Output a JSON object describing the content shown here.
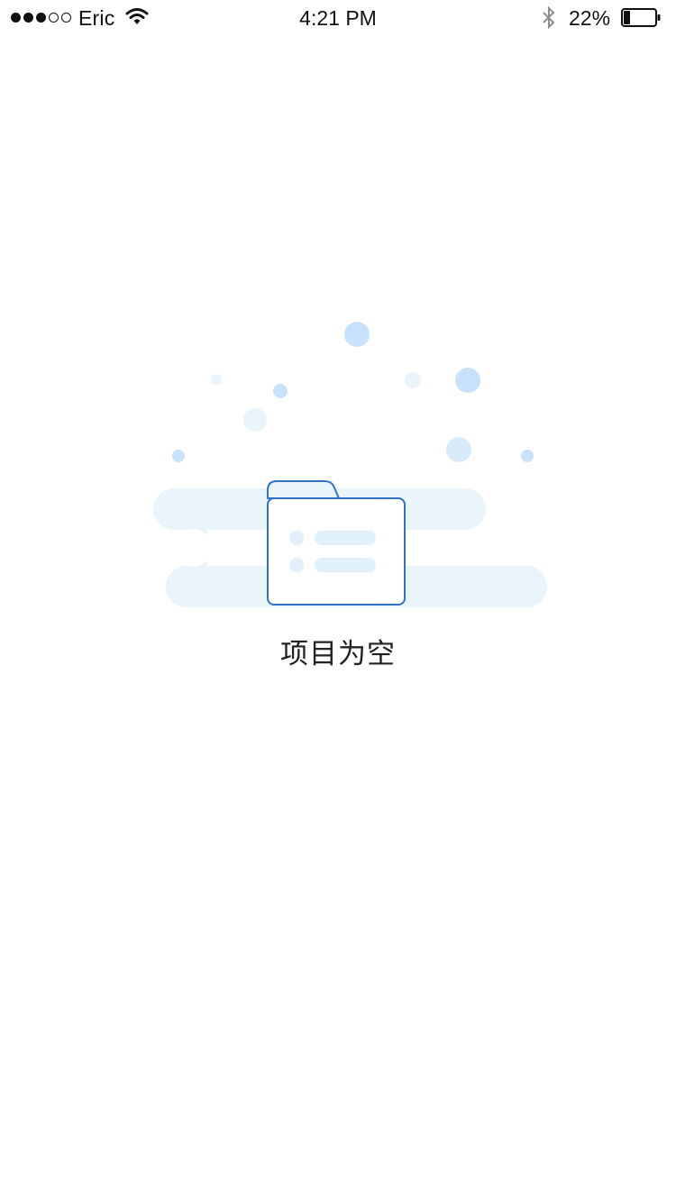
{
  "status_bar": {
    "carrier": "Eric",
    "time": "4:21 PM",
    "battery_percent": "22%",
    "battery_level": 0.22,
    "signal_strength": 3,
    "signal_max": 5,
    "icons": [
      "signal-dots-icon",
      "wifi-icon",
      "bluetooth-icon",
      "battery-icon"
    ]
  },
  "empty_state": {
    "message": "项目为空",
    "illustration_icon": "empty-folder-icon",
    "colors": {
      "outline": "#2f72c8",
      "soft_blue": "#e9f4fb",
      "bubble_blue": "#c9e2fb",
      "line_fill": "#dff0fb"
    }
  }
}
